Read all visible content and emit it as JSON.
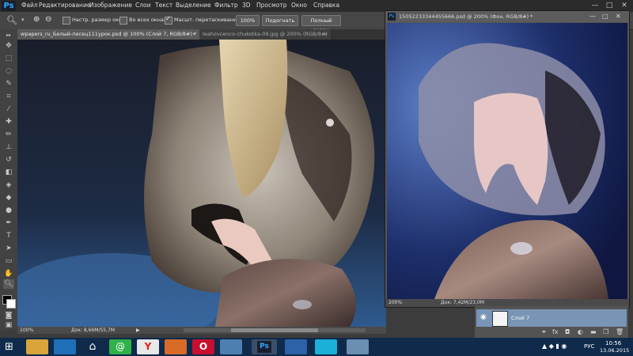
{
  "app": {
    "logo": "Ps"
  },
  "menu": [
    "Файл",
    "Редактирование",
    "Изображение",
    "Слои",
    "Текст",
    "Выделение",
    "Фильтр",
    "3D",
    "Просмотр",
    "Окно",
    "Справка"
  ],
  "window_controls": [
    "—",
    "□",
    "✕"
  ],
  "options": {
    "resize_windows": "Настр. размер окон",
    "all_windows": "Во всех окнах",
    "scrubby_zoom": "Масшт. перетаскиванием",
    "zoom_value": "100%",
    "fit_screen": "Подогнать",
    "fill_screen": "Полный экран"
  },
  "tabs": [
    "wpapers_ru_Белый-песец111урок.psd @ 100% (Слой 7, RGB/8#) *",
    "leahovcenco-chukotka-09.jpg @ 200% (RGB/8#)"
  ],
  "main_status": {
    "zoom": "100%",
    "doc": "Док: 8,66М/55,7М"
  },
  "float_doc": {
    "title": "15052233344455666.psd @ 200% (Фон, RGB/8#) *",
    "zoom": "200%",
    "doc": "Док: 7,42М/23,0М"
  },
  "layers": {
    "layer_name": "Слой 7"
  },
  "taskbar": {
    "lang": "РУС",
    "time": "10:56",
    "date": "13.06.2015"
  },
  "colors": {
    "menu_bg": "#2b2b2b",
    "panel_bg": "#464646",
    "taskbar_bg": "#0f2a4a",
    "active_layer": "#7895b5"
  }
}
